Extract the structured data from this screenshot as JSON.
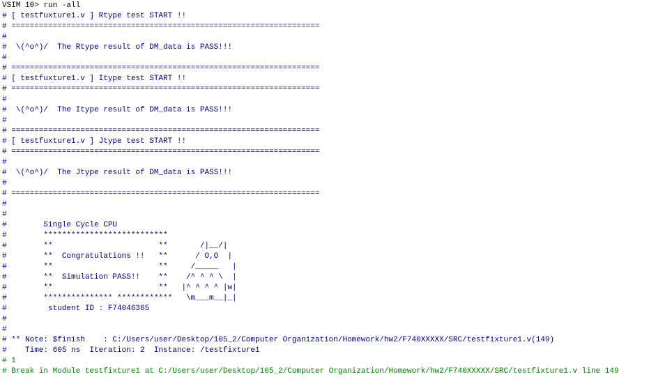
{
  "transcript": {
    "prompt": "VSIM 10> run -all",
    "lines": [
      "# [ testfuxture1.v ] Rtype test START !!",
      "# ===================================================================",
      "#",
      "#  \\(^o^)/  The Rtype result of DM_data is PASS!!!",
      "#",
      "# ===================================================================",
      "# [ testfuxture1.v ] Itype test START !!",
      "# ===================================================================",
      "#",
      "#  \\(^o^)/  The Itype result of DM_data is PASS!!!",
      "#",
      "# ===================================================================",
      "# [ testfuxture1.v ] Jtype test START !!",
      "# ===================================================================",
      "#",
      "#  \\(^o^)/  The Jtype result of DM_data is PASS!!!",
      "#",
      "# ===================================================================",
      "#",
      "#",
      "#        Single Cycle CPU",
      "#        ***************************",
      "#        **                       **       /|__/|",
      "#        **  Congratulations !!   **      / O,O  |",
      "#        **                       **     /_____   |",
      "#        **  Simulation PASS!!    **    /^ ^ ^ \\  |",
      "#        **                       **   |^ ^ ^ ^ |w|",
      "#        *************** ************   \\m___m__|_|",
      "#         student ID : F74046365",
      "#",
      "#",
      "# ** Note: $finish    : C:/Users/user/Desktop/105_2/Computer Organization/Homework/hw2/F740XXXXX/SRC/testfixture1.v(149)",
      "#    Time: 605 ns  Iteration: 2  Instance: /testfixture1",
      "# 1",
      "# Break in Module testfixture1 at C:/Users/user/Desktop/105_2/Computer Organization/Homework/hw2/F740XXXXX/SRC/testfixture1.v line 149"
    ]
  },
  "colors": {
    "background": "#ffffff",
    "prompt": "#000000",
    "output": "#000080",
    "break": "#008000"
  }
}
